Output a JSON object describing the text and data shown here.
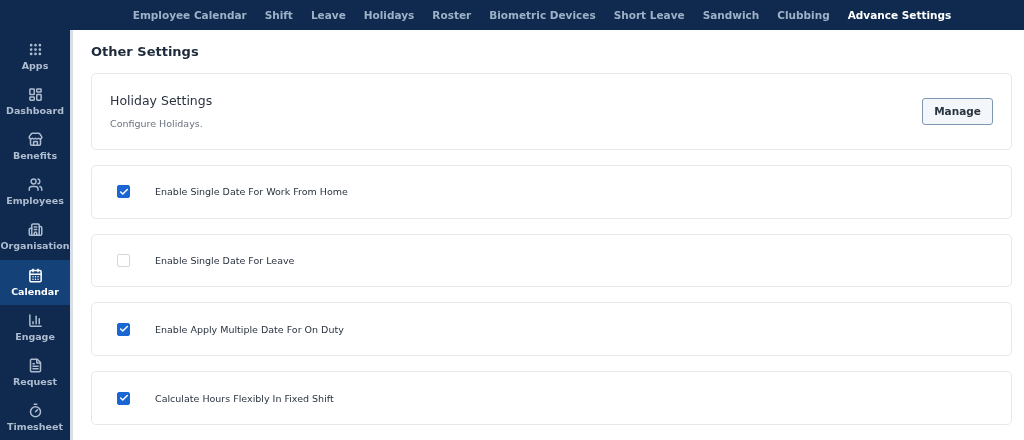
{
  "top_tabs": [
    {
      "label": "Employee Calendar",
      "selected": false
    },
    {
      "label": "Shift",
      "selected": false
    },
    {
      "label": "Leave",
      "selected": false
    },
    {
      "label": "Holidays",
      "selected": false
    },
    {
      "label": "Roster",
      "selected": false
    },
    {
      "label": "Biometric Devices",
      "selected": false
    },
    {
      "label": "Short Leave",
      "selected": false
    },
    {
      "label": "Sandwich",
      "selected": false
    },
    {
      "label": "Clubbing",
      "selected": false
    },
    {
      "label": "Advance Settings",
      "selected": true
    }
  ],
  "sidebar": {
    "items": [
      {
        "label": "Apps",
        "kind": "apps",
        "selected": false
      },
      {
        "label": "Dashboard",
        "kind": "dashboard",
        "selected": false
      },
      {
        "label": "Benefits",
        "kind": "benefits",
        "selected": false
      },
      {
        "label": "Employees",
        "kind": "employees",
        "selected": false
      },
      {
        "label": "Organisation",
        "kind": "organisation",
        "selected": false
      },
      {
        "label": "Calendar",
        "kind": "calendar",
        "selected": true
      },
      {
        "label": "Engage",
        "kind": "engage",
        "selected": false
      },
      {
        "label": "Request",
        "kind": "request",
        "selected": false
      },
      {
        "label": "Timesheet",
        "kind": "timesheet",
        "selected": false
      }
    ]
  },
  "page_title": "Other Settings",
  "holiday_card": {
    "title": "Holiday Settings",
    "description": "Configure Holidays.",
    "button": "Manage"
  },
  "options": [
    {
      "label": "Enable Single Date For Work From Home",
      "checked": true
    },
    {
      "label": "Enable Single Date For Leave",
      "checked": false
    },
    {
      "label": "Enable Apply Multiple Date For On Duty",
      "checked": true
    },
    {
      "label": "Calculate Hours Flexibly In Fixed Shift",
      "checked": true
    }
  ]
}
